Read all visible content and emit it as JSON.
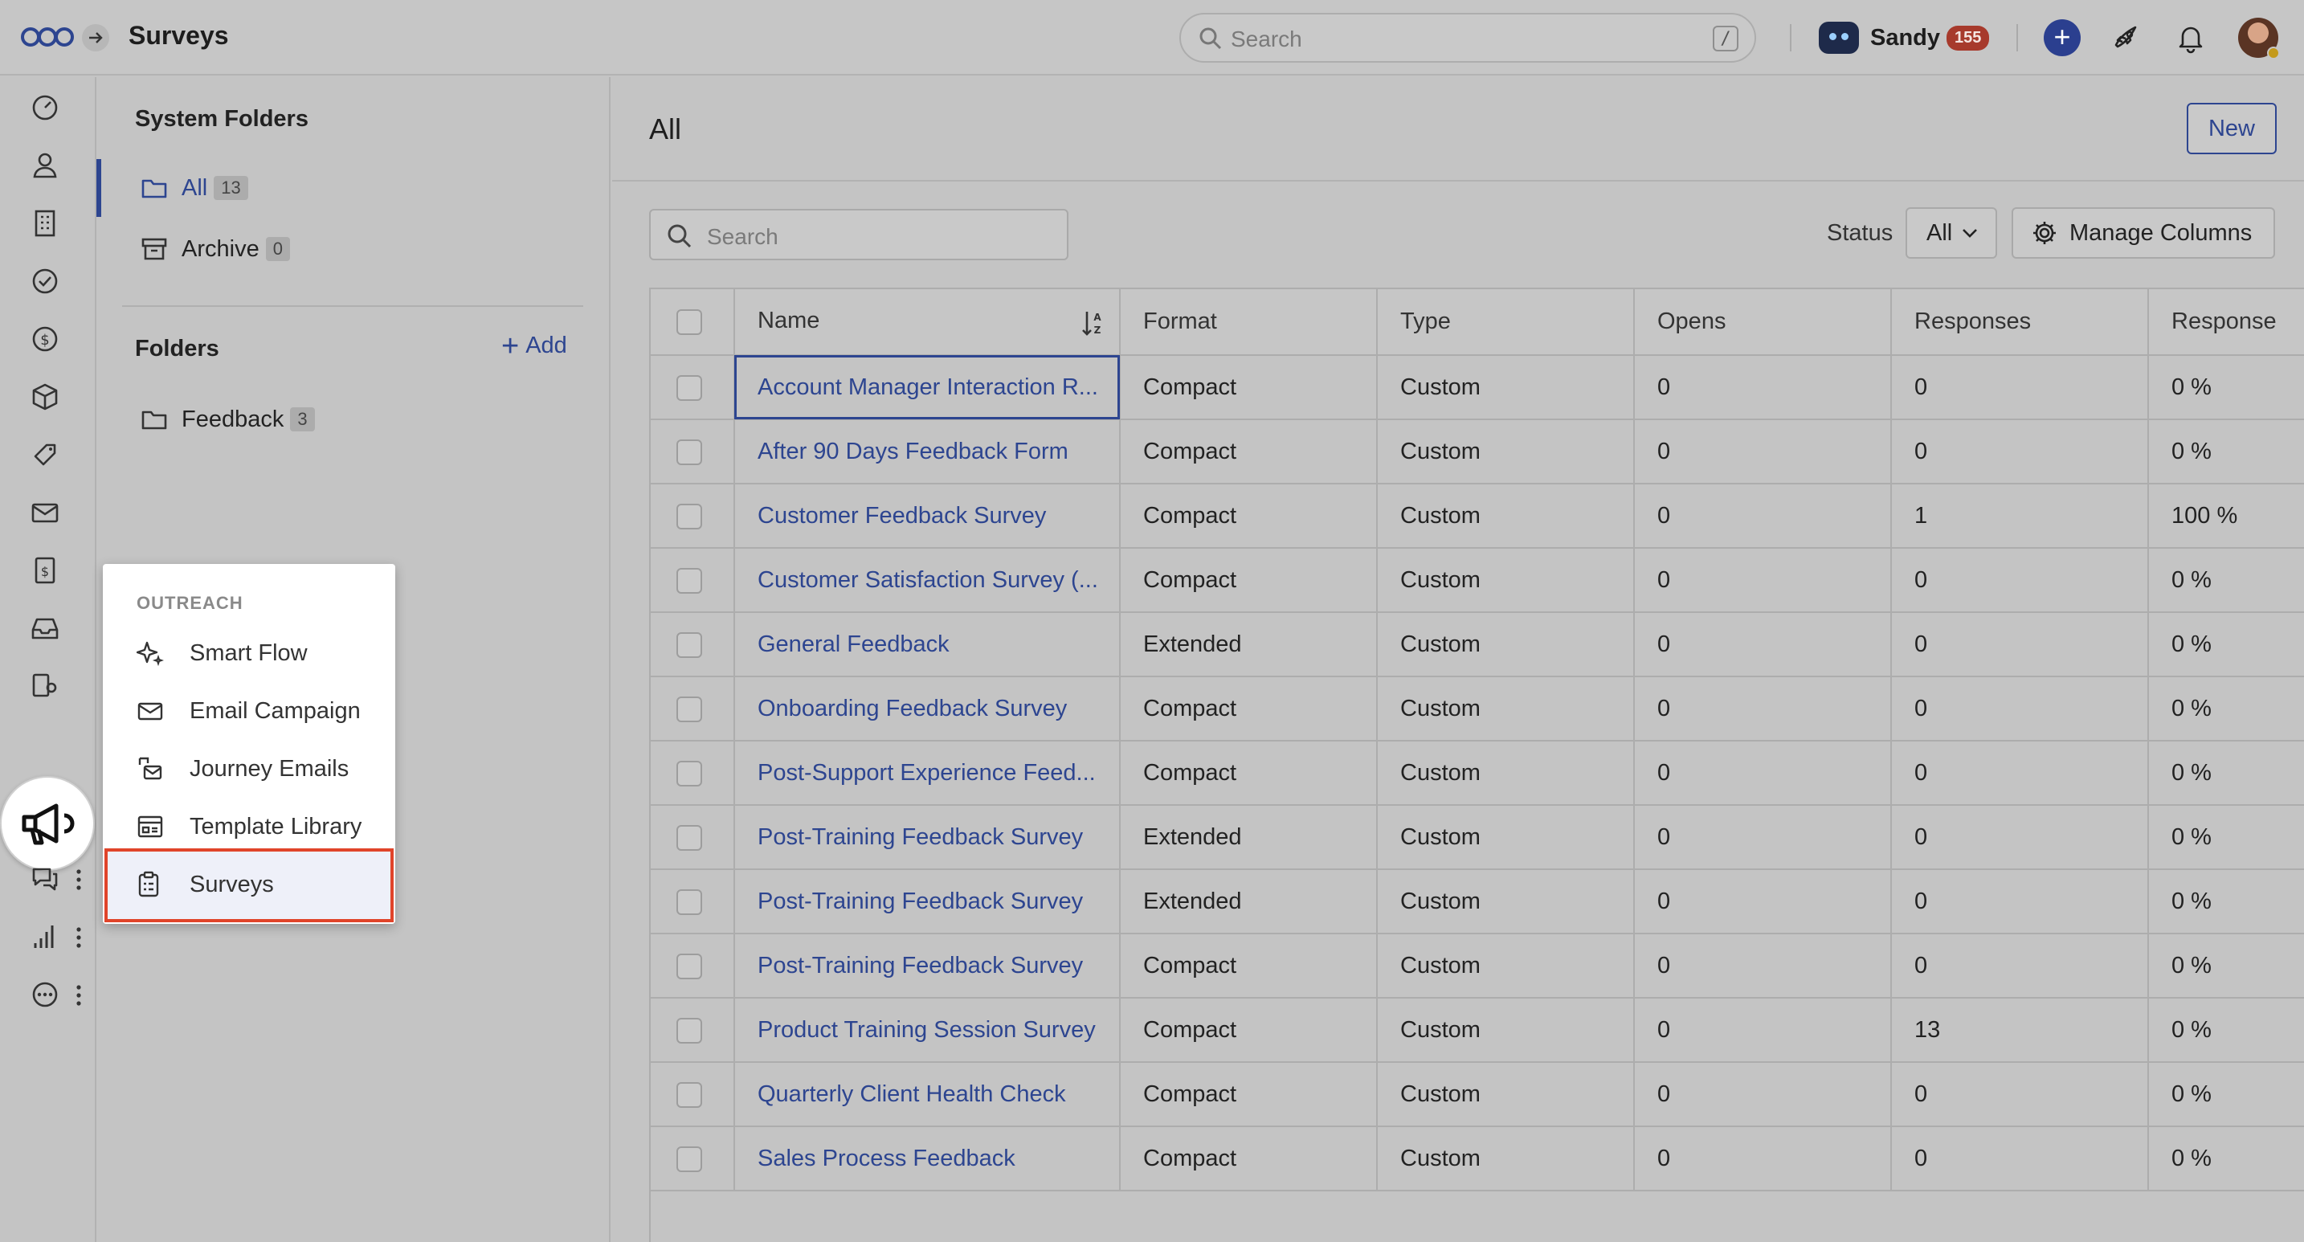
{
  "app": {
    "title": "Surveys"
  },
  "top_search": {
    "placeholder": "Search",
    "shortcut": "/"
  },
  "user": {
    "name": "Sandy",
    "badge_count": "155"
  },
  "system_folders": {
    "heading": "System Folders",
    "items": [
      {
        "label": "All",
        "count": "13",
        "active": true
      },
      {
        "label": "Archive",
        "count": "0",
        "active": false
      }
    ]
  },
  "folders": {
    "heading": "Folders",
    "add_label": "Add",
    "items": [
      {
        "label": "Feedback",
        "count": "3"
      }
    ]
  },
  "main": {
    "title": "All",
    "new_button": "New",
    "search_placeholder": "Search",
    "status_label": "Status",
    "status_value": "All",
    "manage_columns": "Manage Columns"
  },
  "table": {
    "columns": [
      "Name",
      "Format",
      "Type",
      "Opens",
      "Responses",
      "Response"
    ],
    "rows": [
      [
        "Account Manager Interaction R...",
        "Compact",
        "Custom",
        "0",
        "0",
        "0 %"
      ],
      [
        "After 90 Days Feedback Form",
        "Compact",
        "Custom",
        "0",
        "0",
        "0 %"
      ],
      [
        "Customer Feedback Survey",
        "Compact",
        "Custom",
        "0",
        "1",
        "100 %"
      ],
      [
        "Customer Satisfaction Survey (...",
        "Compact",
        "Custom",
        "0",
        "0",
        "0 %"
      ],
      [
        "General Feedback",
        "Extended",
        "Custom",
        "0",
        "0",
        "0 %"
      ],
      [
        "Onboarding Feedback Survey",
        "Compact",
        "Custom",
        "0",
        "0",
        "0 %"
      ],
      [
        "Post-Support Experience Feed...",
        "Compact",
        "Custom",
        "0",
        "0",
        "0 %"
      ],
      [
        "Post-Training Feedback Survey",
        "Extended",
        "Custom",
        "0",
        "0",
        "0 %"
      ],
      [
        "Post-Training Feedback Survey",
        "Extended",
        "Custom",
        "0",
        "0",
        "0 %"
      ],
      [
        "Post-Training Feedback Survey",
        "Compact",
        "Custom",
        "0",
        "0",
        "0 %"
      ],
      [
        "Product Training Session Survey",
        "Compact",
        "Custom",
        "0",
        "13",
        "0 %"
      ],
      [
        "Quarterly Client Health Check",
        "Compact",
        "Custom",
        "0",
        "0",
        "0 %"
      ],
      [
        "Sales Process Feedback",
        "Compact",
        "Custom",
        "0",
        "0",
        "0 %"
      ]
    ]
  },
  "outreach_menu": {
    "section": "OUTREACH",
    "items": [
      {
        "label": "Smart Flow",
        "icon": "sparkle-icon"
      },
      {
        "label": "Email Campaign",
        "icon": "mail-icon"
      },
      {
        "label": "Journey Emails",
        "icon": "journey-mail-icon"
      },
      {
        "label": "Template Library",
        "icon": "template-icon"
      },
      {
        "label": "Surveys",
        "icon": "clipboard-icon",
        "active": true
      }
    ]
  },
  "colors": {
    "accent": "#2d4590",
    "highlight_border": "#e0442a",
    "badge": "#a73a2c"
  }
}
